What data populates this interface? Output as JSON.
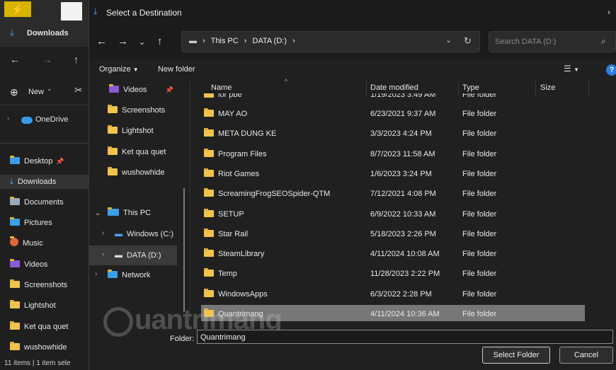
{
  "background_window": {
    "toolbar": {
      "new_label": "New"
    },
    "onedrive_label": "OneDrive",
    "quick_access": [
      {
        "label": "Desktop"
      },
      {
        "label": "Downloads"
      },
      {
        "label": "Documents"
      },
      {
        "label": "Pictures"
      },
      {
        "label": "Music"
      },
      {
        "label": "Videos"
      },
      {
        "label": "Screenshots"
      },
      {
        "label": "Lightshot"
      },
      {
        "label": "Ket qua quet"
      },
      {
        "label": "wushowhide"
      }
    ],
    "tab_label": "Downloads",
    "status": "11 items  |  1 item sele"
  },
  "dialog": {
    "title": "Select a Destination",
    "address": {
      "parts": [
        "This PC",
        "DATA (D:)"
      ]
    },
    "search_placeholder": "Search DATA (D:)",
    "organize_label": "Organize",
    "new_folder_label": "New folder",
    "nav_pane": {
      "items": [
        {
          "label": "Videos"
        },
        {
          "label": "Screenshots"
        },
        {
          "label": "Lightshot"
        },
        {
          "label": "Ket qua quet"
        },
        {
          "label": "wushowhide"
        },
        {
          "label": "This PC"
        },
        {
          "label": "Windows (C:)"
        },
        {
          "label": "DATA (D:)"
        },
        {
          "label": "Network"
        }
      ]
    },
    "columns": {
      "name": "Name",
      "date": "Date modified",
      "type": "Type",
      "size": "Size"
    },
    "partial_row": {
      "name": "ior pbe",
      "date": "1/19/2023 3:49 AM",
      "type": "File folder"
    },
    "rows": [
      {
        "name": "MAY AO",
        "date": "6/23/2021 9:37 AM",
        "type": "File folder"
      },
      {
        "name": "META DUNG KE",
        "date": "3/3/2023 4:24 PM",
        "type": "File folder"
      },
      {
        "name": "Program Files",
        "date": "8/7/2023 11:58 AM",
        "type": "File folder"
      },
      {
        "name": "Riot Games",
        "date": "1/6/2023 3:24 PM",
        "type": "File folder"
      },
      {
        "name": "ScreamingFrogSEOSpider-QTM",
        "date": "7/12/2021 4:08 PM",
        "type": "File folder"
      },
      {
        "name": "SETUP",
        "date": "6/9/2022 10:33 AM",
        "type": "File folder"
      },
      {
        "name": "Star Rail",
        "date": "5/18/2023 2:26 PM",
        "type": "File folder"
      },
      {
        "name": "SteamLibrary",
        "date": "4/11/2024 10:08 AM",
        "type": "File folder"
      },
      {
        "name": "Temp",
        "date": "11/28/2023 2:22 PM",
        "type": "File folder"
      },
      {
        "name": "WindowsApps",
        "date": "6/3/2022 2:28 PM",
        "type": "File folder"
      },
      {
        "name": "Quantrimang",
        "date": "4/11/2024 10:36 AM",
        "type": "File folder",
        "selected": true
      }
    ],
    "folder_field": {
      "label": "Folder:",
      "value": "Quantrimang"
    },
    "select_button": "Select Folder",
    "cancel_button": "Cancel"
  },
  "watermark": "uantrimang",
  "colors": {
    "accent": "#2c7be5",
    "folder": "#f0c44c",
    "selected_row": "#777777"
  }
}
